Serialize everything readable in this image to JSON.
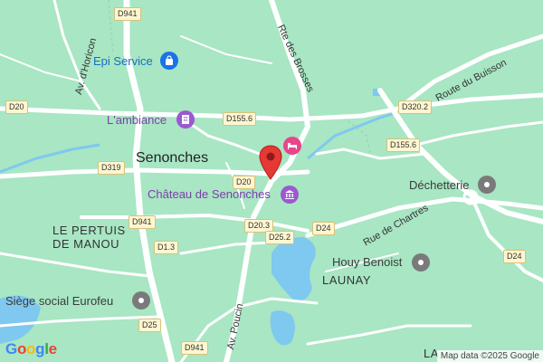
{
  "towns": {
    "senonches": "Senonches",
    "launay": "LAUNAY",
    "le_pertuis_1": "LE PERTUIS",
    "le_pertuis_2": "DE MANOU",
    "la_bottom": "LA"
  },
  "streets": {
    "rte_brosses": "Rte des Brosses",
    "route_buisson": "Route du Buisson",
    "av_horicon": "Av. d'Horicon",
    "rue_chartres": "Rue de Chartres",
    "av_poucin": "Av. Poucin"
  },
  "road_shields": [
    "D941",
    "D20",
    "D155.6",
    "D319",
    "D20",
    "D941",
    "D1.3",
    "D20.3",
    "D25.2",
    "D24",
    "D25",
    "D941",
    "D320.2",
    "D155.6",
    "D24"
  ],
  "pois": {
    "epi_service": {
      "label": "Epi Service",
      "icon": "shopping-bag-icon",
      "color": "#1a73e8"
    },
    "lambiance": {
      "label": "L'ambiance",
      "icon": "building-icon",
      "color": "#9b59d0"
    },
    "chateau": {
      "label": "Château de Senonches",
      "icon": "museum-icon",
      "color": "#9b59d0"
    },
    "hotel": {
      "label": "",
      "icon": "bed-icon",
      "color": "#e8458a"
    },
    "decheterie": {
      "label": "Déchetterie",
      "icon": "place-icon",
      "color": "#7a7a7a"
    },
    "houy_benoist": {
      "label": "Houy Benoist",
      "icon": "place-icon",
      "color": "#7a7a7a"
    },
    "siege_eurofeu": {
      "label": "Siège social Eurofeu",
      "icon": "place-icon",
      "color": "#7a7a7a"
    }
  },
  "marker": {
    "icon": "red-map-pin-icon",
    "color": "#e53935"
  },
  "branding": {
    "logo": "Google",
    "attribution": "Map data ©2025 Google"
  },
  "colors": {
    "land": "#a8e6c4",
    "road": "#ffffff",
    "water": "#7fc8f0"
  }
}
